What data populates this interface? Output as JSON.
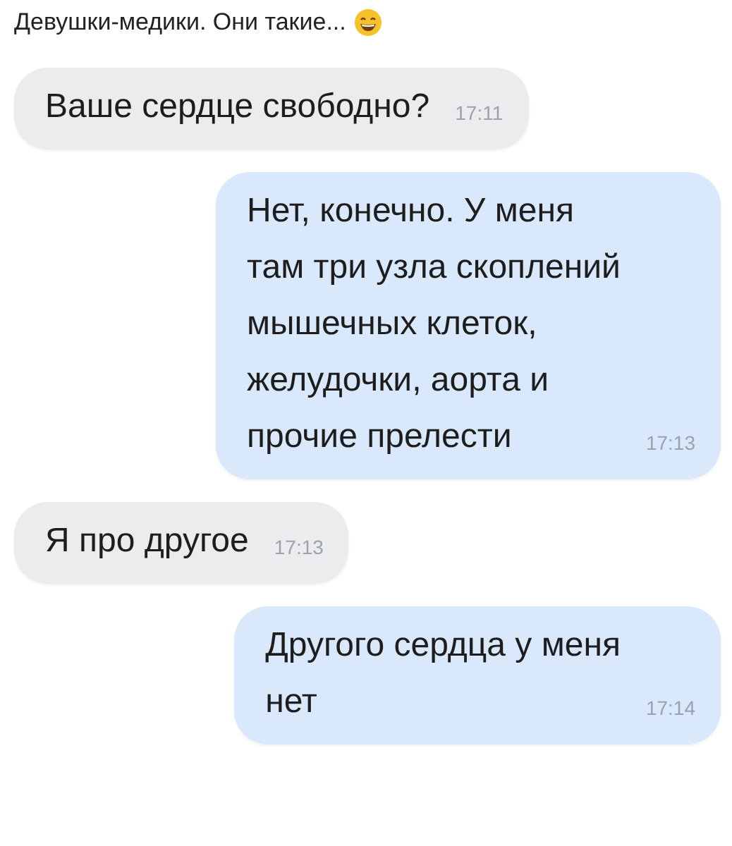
{
  "caption": "Девушки-медики. Они такие...",
  "messages": [
    {
      "kind": "incoming",
      "text": "Ваше сердце свободно?",
      "time": "17:11"
    },
    {
      "kind": "outgoing",
      "text": "Нет, конечно. У меня\nтам три узла скоплений\nмышечных клеток,\nжелудочки, аорта и\nпрочие прелести",
      "time": "17:13"
    },
    {
      "kind": "incoming",
      "text": "Я про другое",
      "time": "17:13"
    },
    {
      "kind": "outgoing",
      "text": "Другого сердца у меня\nнет",
      "time": "17:14"
    }
  ]
}
